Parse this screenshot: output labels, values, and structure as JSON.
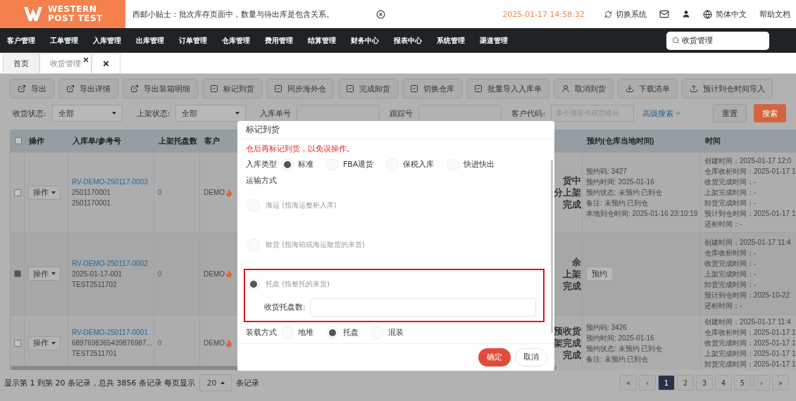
{
  "header": {
    "logo": {
      "line1": "WESTERN",
      "line2": "POST",
      "tag": "TEST"
    },
    "tip": "西邮小贴士：批次库存页面中，数量与待出库是包含关系。",
    "datetime": "2025-01-17 14:58:32",
    "switch_system": "切换系统",
    "language": "简体中文",
    "help": "帮助文档"
  },
  "nav": {
    "items": [
      "客户管理",
      "工单管理",
      "入库管理",
      "出库管理",
      "订单管理",
      "仓库管理",
      "费用管理",
      "结算管理",
      "财务中心",
      "报表中心",
      "系统管理",
      "渠道管理"
    ],
    "search": {
      "value": "收货管理"
    }
  },
  "tabs": [
    {
      "label": "首页",
      "selected": false,
      "closable": false
    },
    {
      "label": "收货管理",
      "selected": true,
      "closable": true
    }
  ],
  "toolbar": [
    "导出",
    "导出详情",
    "导出装箱明细",
    "标记到货",
    "同步海外仓",
    "完成卸货",
    "切换仓库",
    "批量导入入库单",
    "取消到货",
    "下载清单",
    "预计到仓时间导入"
  ],
  "filters": [
    {
      "label": "收货状态:",
      "kind": "select",
      "value": "全部"
    },
    {
      "label": "上架状态:",
      "kind": "select",
      "value": "全部"
    },
    {
      "label": "入库单号",
      "kind": "input"
    },
    {
      "label": "跟踪号",
      "kind": "input"
    },
    {
      "label": "客户代码:",
      "kind": "input",
      "placeholder": "多个用逗号或空格分"
    }
  ],
  "advanced_search": "高级搜索",
  "reset": "重置",
  "search": "搜索",
  "table": {
    "header_checked": false,
    "columns": [
      "操作",
      "入库单/参考号",
      "上架托盘数",
      "客户",
      "预约(仓库当地时间)",
      "时间"
    ],
    "rows": [
      {
        "checked": false,
        "action": "操作",
        "order_no": "RV-DEMO-250117-0003",
        "refs": [
          "2501170001",
          "2501170001"
        ],
        "pallets": "0",
        "customer": "DEMO",
        "hot": true,
        "status": [
          "货中",
          "分上架",
          "完成"
        ],
        "appointment": {
          "kind": "info",
          "lines": [
            "预约码: 3427",
            "预约时间: 2025-01-16",
            "预约状态: 未预约 已到仓",
            "备注: 未预约 已到仓",
            "本地到仓时间: 2025-01-16 23:10:19"
          ]
        },
        "times": [
          "创建时间：2025-01-17 12:0",
          "仓库收柜时间：2025-01-17 1",
          "收货完成时间：-",
          "上架完成时间：-",
          "卸货完成时间：-",
          "预计到仓时间：2025-01-17 1",
          "还柜时间：-"
        ]
      },
      {
        "checked": true,
        "action": "操作",
        "order_no": "RV-DEMO-250117-0002",
        "refs": [
          "2025-01-17-001",
          "TEST2511702"
        ],
        "pallets": "0",
        "customer": "DEMO",
        "hot": true,
        "status": [
          "余",
          "上架",
          "完成"
        ],
        "appointment": {
          "kind": "button",
          "label": "预约"
        },
        "times": [
          "创建时间：2025-01-17 11:4",
          "仓库收柜时间：-",
          "收货完成时间：-",
          "上架完成时间：-",
          "卸货完成时间：-",
          "预计到仓时间：2025-10-22",
          "还柜时间：-"
        ]
      },
      {
        "checked": false,
        "action": "操作",
        "order_no": "RV-DEMO-250117-0001",
        "refs": [
          "6897698365439876987...",
          "TEST2511701"
        ],
        "pallets": "0",
        "customer": "DEMO",
        "hot": true,
        "status": [
          "预收货",
          "架完成",
          "完成"
        ],
        "appointment": {
          "kind": "info",
          "lines": [
            "预约码: 3426",
            "预约时间: 2025-01-16",
            "预约状态: 未预约 已到仓",
            "备注: 未预约 已到仓"
          ]
        },
        "times": [
          "创建时间：2025-01-17 11:4",
          "仓库收柜时间：2025-01-17 1",
          "收货完成时间：2025-01-17 1",
          "上架完成时间：2025-01-17 1",
          "卸货完成时间：2025-01-17 1"
        ]
      }
    ]
  },
  "footer": {
    "summary": "显示第 1 到第 20 条记录，总共 3856 条记录 每页显示",
    "page_size": "20",
    "suffix": "条记录",
    "pages": [
      {
        "label": "«",
        "selected": false
      },
      {
        "label": "‹",
        "selected": false
      },
      {
        "label": "1",
        "selected": true
      },
      {
        "label": "2",
        "selected": false
      },
      {
        "label": "3",
        "selected": false
      },
      {
        "label": "4",
        "selected": false
      },
      {
        "label": "5",
        "selected": false
      },
      {
        "label": "›",
        "selected": false
      },
      {
        "label": "»",
        "selected": false
      }
    ]
  },
  "modal": {
    "title": "标记到货",
    "warning": "仓后再标记到货，以免误操作。",
    "inbound_type": {
      "label": "入库类型",
      "options": [
        {
          "label": "标准",
          "selected": true
        },
        {
          "label": "FBA退货",
          "selected": false
        },
        {
          "label": "保税入库",
          "selected": false
        },
        {
          "label": "快进快出",
          "selected": false
        }
      ]
    },
    "transport": {
      "label": "运输方式",
      "options": [
        {
          "label": "海运 (指海运整柜入库)",
          "selected": false,
          "highlighted": false
        },
        {
          "label": "散货 (指海箱或海运散货的来货)",
          "selected": false,
          "highlighted": false
        },
        {
          "label": "托盘 (指整托的来货)",
          "selected": true,
          "highlighted": true,
          "field": {
            "label": "收货托盘数:"
          }
        }
      ]
    },
    "loading": {
      "label": "装载方式",
      "options": [
        {
          "label": "地堆",
          "selected": false
        },
        {
          "label": "托盘",
          "selected": true
        },
        {
          "label": "混装",
          "selected": false
        }
      ]
    },
    "confirm": "确定",
    "cancel": "取消"
  }
}
